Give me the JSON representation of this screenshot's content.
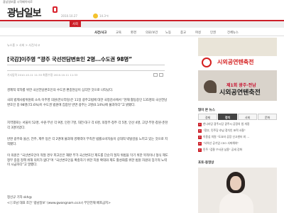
{
  "topbar": {
    "links": "광남일보를 시작페이지로",
    "right": ""
  },
  "header": {
    "logo": "광남일보",
    "date": "2010.10.27",
    "weather": "14.3℃"
  },
  "nav": {
    "items": [
      "",
      "",
      "",
      "",
      "사회",
      "",
      "",
      "",
      "",
      "",
      "",
      "",
      ""
    ],
    "active_index": 4
  },
  "subnav": {
    "items": [
      "사건/사고",
      "교육",
      "환경",
      "의료/보건",
      "노동",
      "종교",
      "여성",
      "인권",
      "전체뉴스"
    ],
    "active": "사건/사고"
  },
  "breadcrumb": "뉴스홈 > 사회 > 사건/사고",
  "article": {
    "headline": "[국감]이주영 “광주 국선전담변호인 2명...수도권 98명”",
    "meta": [
      "",
      "",
      "",
      "",
      ""
    ],
    "dates": "기사입력 2010.10.11 11:33   최종수정 2010.10.11 11:33",
    "paragraphs": [
      "경제적 약자를 위한 국선전담변호인의 수도권 편중현상이 심각한 것으로 나타났다.",
      "국회 법제사법위원회 소속 이주영 의원(한나라당)은 11일 광주고법에 대한 국정감사에서 “현재 활동중인 135명의 국선전담변호인 중 98명(72.6%)이 수도권 법원에 집중된 반면 광주는 2명(0.14%)에 불과하다”고 밝혔다.",
      "지역별로는 서울이 52명, 수원·부산 각 9명, 인천 7명, 대전·대구 각 6명, 의정부·청주 각 5명, 인산 4명, 고양·부천·창원·춘천 각 3명이었다.",
      "반면 광주와 울산, 전주, 제주 등은 각 2명에 불과해 경제력이 부족한 법률소비자들이 상대적 박탈감을 느끼고 있는 것으로 지적됐다.",
      "이 의원은 “국선변호인이 적절 경우 피고인은 재판 부가 국선변호인 제도를 단순히 절차 위법을 막기 위한 목적이나 형식 제도 정부 중점 정책 위해 의미가 없다”며 “국선변호인을 확충하기 위한 지원 확대와 제도 활성화를 위한 법원 차원의 장기적 노력이 시급하다”고 말했다.",
      "정선규 기자 skh@",
      "<ⓒ호남 대표 조간 '광남일보' (www.gwangnam.co.kr) 무단전재 배포금지>"
    ]
  },
  "sidebar": {
    "banner1_text": "시외공연텐축전",
    "banner1_small": "",
    "banner2_line1": "제1회 광주·전남",
    "banner2_line2": "시외공연텐축전",
    "most_read_title": "많이 본 뉴스",
    "tabs": [
      "경제",
      "정치",
      "사회",
      "문화"
    ],
    "active_tab": "정치",
    "rank_items": [
      "한나라당 광주시당 광주시 공정의 법 개정",
      "\"정부, 민주당·호남 정치인 표적 사찰\"",
      "이용섭 의원 \"도요타 공장 신고센터 외 ...",
      "\"낙하산 공기업 CEO 사퇴해야\"",
      "민주 \"검찰 수사권 남용\" 공세 강화"
    ],
    "photo_title": "포토·동영상",
    "photo_nav": ""
  }
}
